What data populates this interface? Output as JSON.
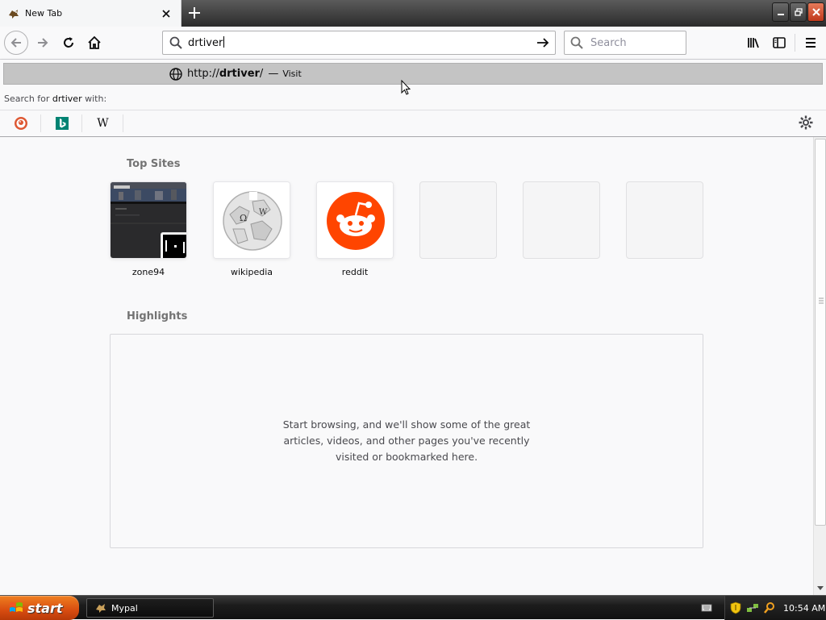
{
  "tab": {
    "title": "New Tab"
  },
  "navbar": {
    "url_text": "drtiver",
    "search_placeholder": "Search"
  },
  "autocomplete": {
    "result_url_prefix": "http://",
    "result_url_host": "drtiver",
    "result_url_suffix": "/",
    "result_dash": "—",
    "result_action": "Visit",
    "search_with_prefix": "Search for ",
    "search_with_term": "drtiver",
    "search_with_suffix": " with:",
    "engines": [
      "duckduckgo-icon",
      "bing-icon",
      "wikipedia-icon"
    ],
    "wiki_glyph": "W"
  },
  "content": {
    "top_sites_title": "Top Sites",
    "top_sites": [
      {
        "label": "zone94"
      },
      {
        "label": "wikipedia"
      },
      {
        "label": "reddit"
      }
    ],
    "highlights_title": "Highlights",
    "highlights_empty": "Start browsing, and we'll show some of the great articles, videos, and other pages you've recently visited or bookmarked here."
  },
  "taskbar": {
    "start_label": "start",
    "task_label": "Mypal",
    "clock": "10:54 AM"
  },
  "colors": {
    "reddit": "#ff4500",
    "bing": "#008373",
    "start": "#d84c10"
  }
}
